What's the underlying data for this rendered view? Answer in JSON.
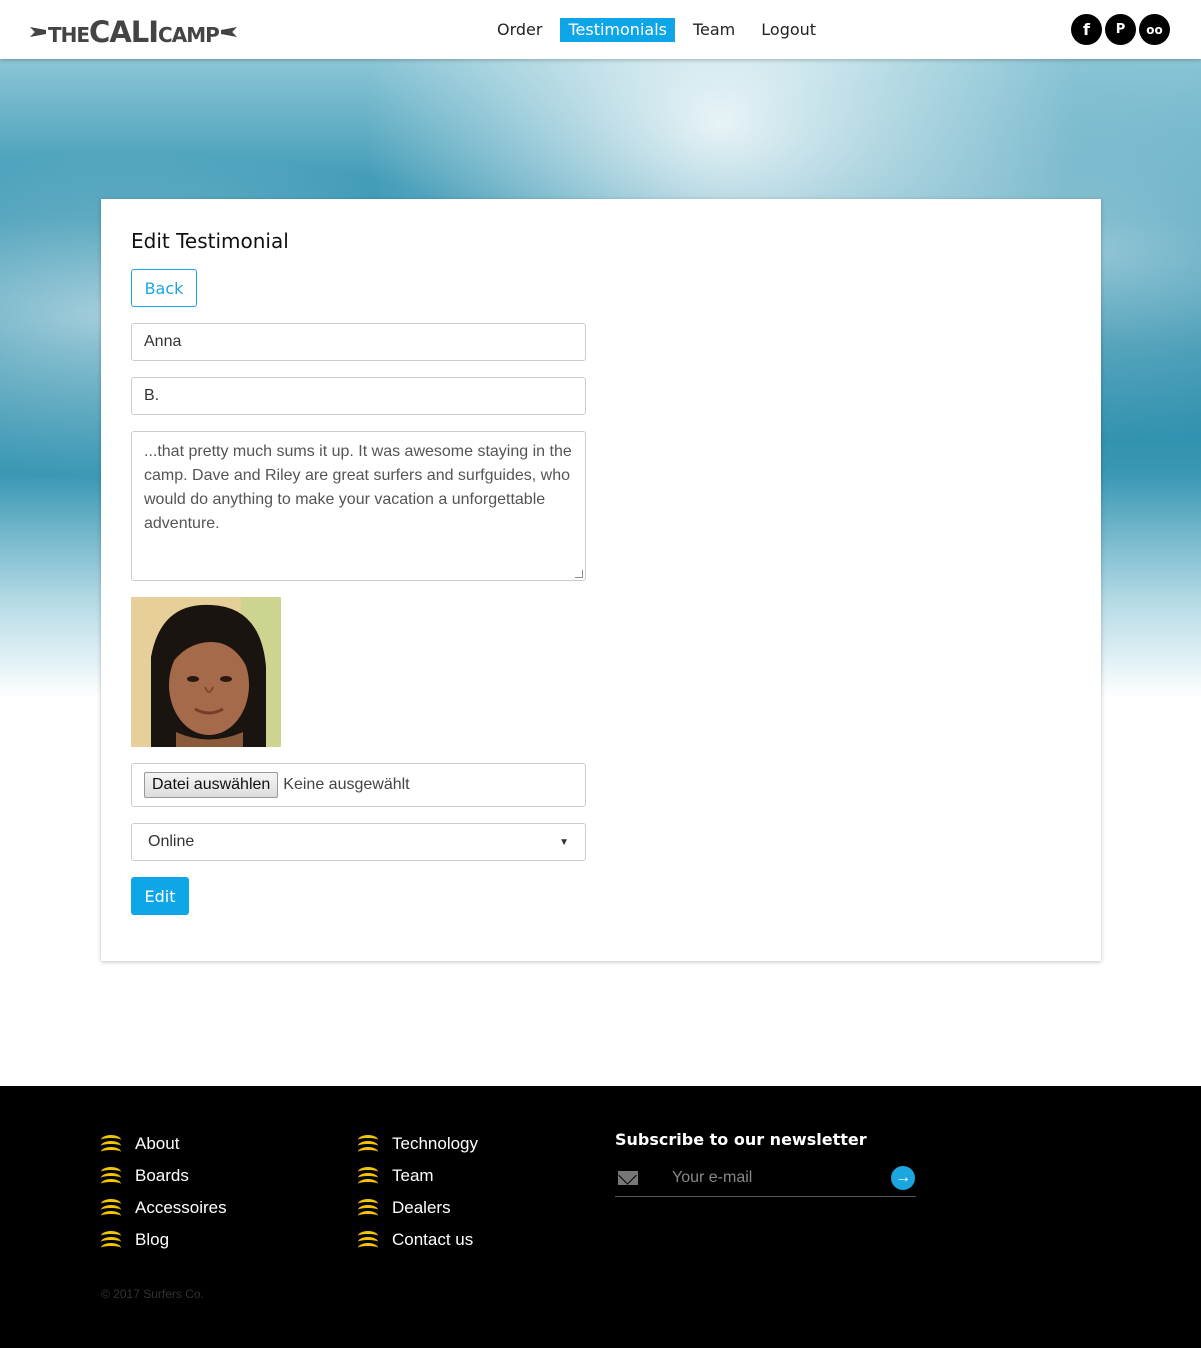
{
  "header": {
    "logo": {
      "the": "THE",
      "cali": "CALI",
      "camp": "CAMP"
    },
    "nav": [
      {
        "label": "Order",
        "active": false
      },
      {
        "label": "Testimonials",
        "active": true
      },
      {
        "label": "Team",
        "active": false
      },
      {
        "label": "Logout",
        "active": false
      }
    ],
    "social": [
      {
        "icon": "facebook-icon",
        "glyph": "f"
      },
      {
        "icon": "pinterest-icon",
        "glyph": "P"
      },
      {
        "icon": "tripadvisor-icon",
        "glyph": "oo"
      }
    ]
  },
  "form": {
    "title": "Edit Testimonial",
    "back_label": "Back",
    "first_name": "Anna",
    "last_name": "B.",
    "text": "...that pretty much sums it up. It was awesome staying in the camp. Dave and Riley are great surfers and surfguides, who would do anything to make your vacation a unforgettable adventure.",
    "file_button": "Datei auswählen",
    "file_status": "Keine ausgewählt",
    "status_value": "Online",
    "submit_label": "Edit"
  },
  "footer": {
    "col1": [
      "About",
      "Boards",
      "Accessoires",
      "Blog"
    ],
    "col2": [
      "Technology",
      "Team",
      "Dealers",
      "Contact us"
    ],
    "newsletter_title": "Subscribe to our newsletter",
    "newsletter_placeholder": "Your e-mail",
    "copyright": "© 2017 Surfers Co."
  },
  "colors": {
    "accent": "#0fa6e8",
    "footer_bg": "#000000",
    "wave_icon": "#f3c400"
  }
}
